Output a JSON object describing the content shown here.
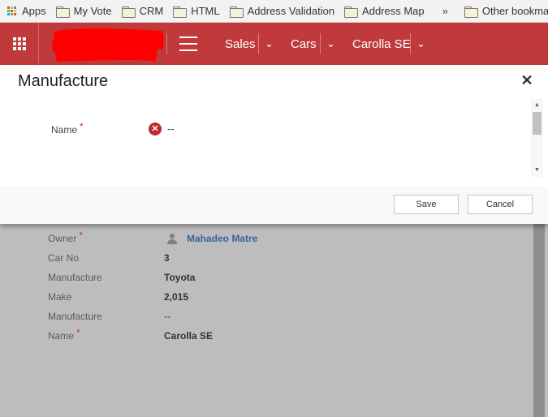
{
  "bookmarks": {
    "apps": "Apps",
    "items": [
      "My Vote",
      "CRM",
      "HTML",
      "Address Validation",
      "Address Map"
    ],
    "overflow_icon": "double-chevron-right-icon",
    "other": "Other bookmarks"
  },
  "header": {
    "bar_color": "#c0393b",
    "nav": [
      {
        "label": "Sales"
      },
      {
        "label": "Cars"
      },
      {
        "label": "Carolla SE"
      }
    ]
  },
  "dialog": {
    "title": "Manufacture",
    "field_label": "Name",
    "required_mark": "*",
    "field_value": "--",
    "save_label": "Save",
    "cancel_label": "Cancel"
  },
  "form": {
    "fields": [
      {
        "label": "Owner",
        "value": "Mahadeo Matre",
        "required": true
      },
      {
        "label": "Car No",
        "value": "3"
      },
      {
        "label": "Manufacture",
        "value": "Toyota"
      },
      {
        "label": "Make",
        "value": "2,015"
      },
      {
        "label": "Manufacture",
        "value": "--"
      },
      {
        "label": "Name",
        "value": "Carolla SE",
        "required": true
      }
    ]
  }
}
